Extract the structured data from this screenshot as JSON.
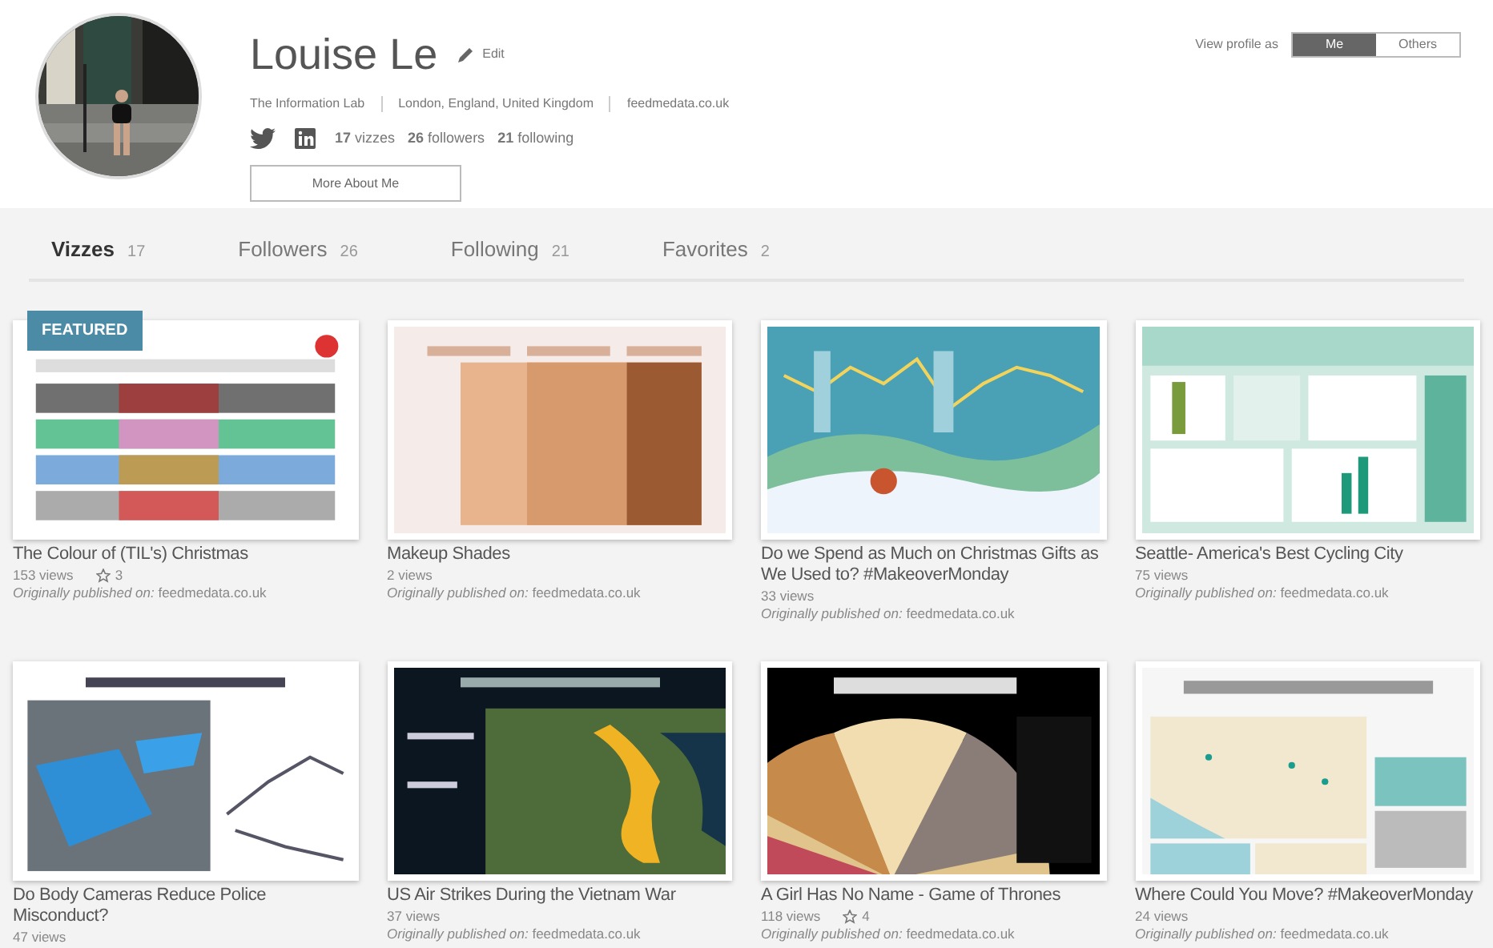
{
  "profile": {
    "name": "Louise Le",
    "edit": "Edit",
    "details": [
      "The Information Lab",
      "London, England, United Kingdom",
      "feedmedata.co.uk"
    ],
    "stats": [
      "**17** vizzes",
      "**26** followers",
      "**21** following"
    ],
    "more_button": "More About Me"
  },
  "view_as": {
    "label": "View profile as",
    "options": [
      {
        "label": "Me",
        "selected": true
      },
      {
        "label": "Others",
        "selected": false
      }
    ]
  },
  "tabs": [
    {
      "label": "Vizzes",
      "count": "17",
      "selected": true
    },
    {
      "label": "Followers",
      "count": "26",
      "selected": false
    },
    {
      "label": "Following",
      "count": "21",
      "selected": false
    },
    {
      "label": "Favorites",
      "count": "2",
      "selected": false
    }
  ],
  "vizzes": [
    {
      "title": "The Colour of (TIL's) Christmas",
      "views": "153 views",
      "favorites": "3",
      "published": "*Originally published on:* feedmedata.co.uk",
      "badge": "FEATURED"
    },
    {
      "title": "Makeup Shades",
      "views": "2 views",
      "published": "*Originally published on:* feedmedata.co.uk"
    },
    {
      "title": "Do we Spend as Much on Christmas Gifts as We Used to? #MakeoverMonday",
      "views": "33 views",
      "published": "*Originally published on:* feedmedata.co.uk"
    },
    {
      "title": "Seattle- America's Best Cycling City",
      "views": "75 views",
      "published": "*Originally published on:* feedmedata.co.uk"
    },
    {
      "title": "Do Body Cameras Reduce Police Misconduct?",
      "views": "47 views"
    },
    {
      "title": "US Air Strikes During the Vietnam War",
      "views": "37 views",
      "published": "*Originally published on:* feedmedata.co.uk"
    },
    {
      "title": "A Girl Has No Name - Game of Thrones",
      "views": "118 views",
      "favorites": "4",
      "published": "*Originally published on:* feedmedata.co.uk"
    },
    {
      "title": "Where Could You Move? #MakeoverMonday",
      "views": "24 views",
      "published": "*Originally published on:* feedmedata.co.uk"
    }
  ]
}
